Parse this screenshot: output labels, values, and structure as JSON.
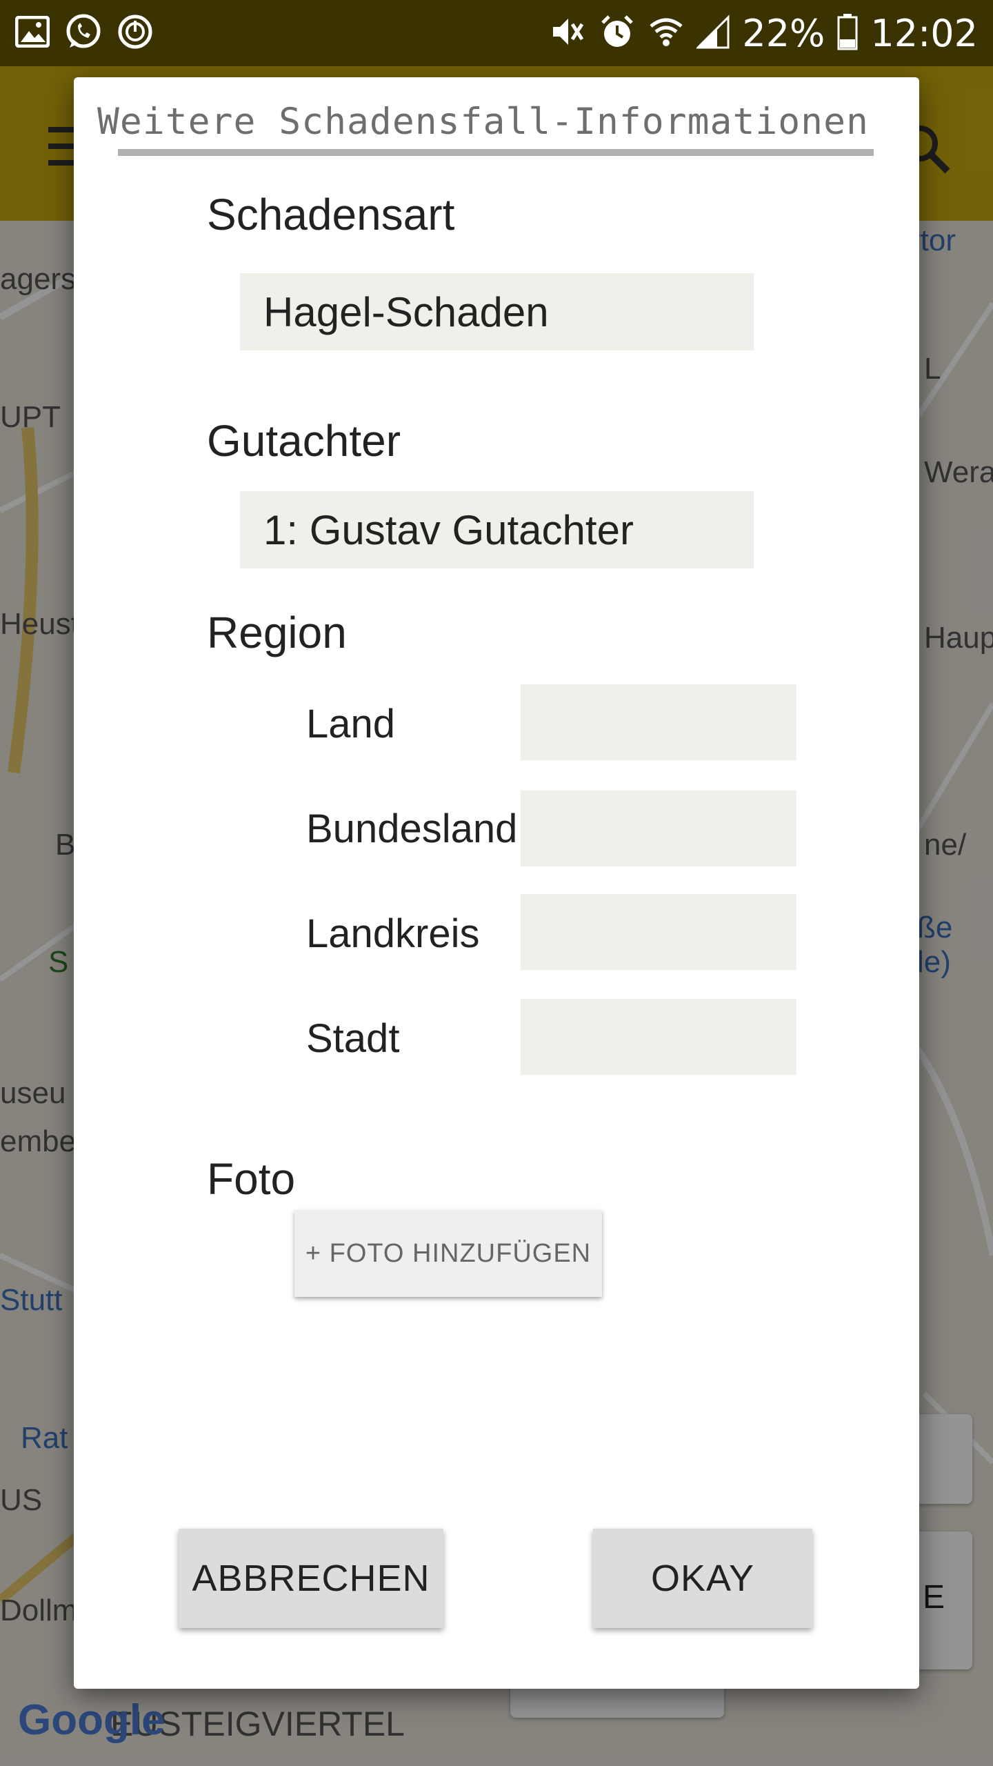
{
  "status_bar": {
    "battery_percent": "22%",
    "time": "12:02",
    "icons": [
      "image-icon",
      "whatsapp-icon",
      "power-icon",
      "mute-icon",
      "alarm-icon",
      "wifi-icon",
      "signal-icon",
      "battery-icon"
    ]
  },
  "map": {
    "labels": [
      "agerstr",
      "UPT",
      "Werastraße",
      "L",
      "rtor",
      "Heusteigviertel",
      "Hauptmannstraße",
      "ße",
      "le)",
      "B",
      "S",
      "useu",
      "embe",
      "Stutt",
      "Rat",
      "US",
      "Dollm",
      "ne/",
      "E",
      "EUSTEIGVIERTEL"
    ],
    "logo": "Google"
  },
  "dialog": {
    "title": "Weitere Schadensfall-Informationen",
    "schadensart": {
      "label": "Schadensart",
      "value": "Hagel-Schaden"
    },
    "gutachter": {
      "label": "Gutachter",
      "value": "1: Gustav Gutachter"
    },
    "region": {
      "label": "Region",
      "fields": [
        {
          "label": "Land",
          "value": ""
        },
        {
          "label": "Bundesland",
          "value": ""
        },
        {
          "label": "Landkreis",
          "value": ""
        },
        {
          "label": "Stadt",
          "value": ""
        }
      ]
    },
    "foto": {
      "label": "Foto",
      "add_button": "+ FOTO HINZUFÜGEN"
    },
    "cancel_button": "ABBRECHEN",
    "ok_button": "OKAY"
  },
  "colors": {
    "status_bar": "#3a3200",
    "toolbar": "#c7a80e",
    "field_bg": "#eff0ea",
    "button_bg": "#dcdcdc"
  }
}
